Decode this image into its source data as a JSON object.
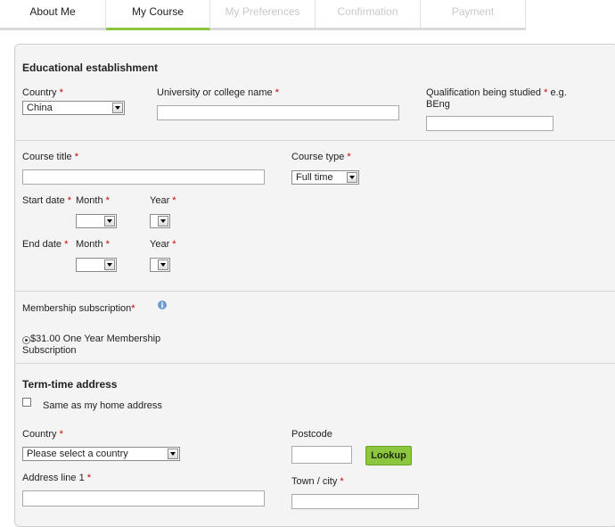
{
  "tabs": [
    {
      "label": "About Me",
      "state": "done"
    },
    {
      "label": "My Course",
      "state": "active"
    },
    {
      "label": "My Preferences",
      "state": "disabled"
    },
    {
      "label": "Confirmation",
      "state": "disabled"
    },
    {
      "label": "Payment",
      "state": "disabled"
    }
  ],
  "colors": {
    "accent": "#8cc63f",
    "required": "#cc0000"
  },
  "education": {
    "heading": "Educational establishment",
    "country_label": "Country",
    "country_value": "China",
    "university_label": "University or college name",
    "qualification_label": "Qualification being studied",
    "qualification_hint_1": "e.g.",
    "qualification_hint_2": "BEng"
  },
  "course": {
    "title_label": "Course title",
    "type_label": "Course type",
    "type_value": "Full time",
    "start_label": "Start date",
    "end_label": "End date",
    "month_label": "Month",
    "year_label": "Year"
  },
  "membership": {
    "label": "Membership subscription",
    "info_icon": "info-icon",
    "option_line1": "$31.00 One Year Membership",
    "option_line2": "Subscription"
  },
  "term_address": {
    "heading": "Term-time address",
    "same_as_home": "Same as my home address",
    "country_label": "Country",
    "country_placeholder": "Please select a country",
    "postcode_label": "Postcode",
    "lookup_label": "Lookup",
    "address1_label": "Address line 1",
    "town_label": "Town / city"
  },
  "req_mark": "*"
}
